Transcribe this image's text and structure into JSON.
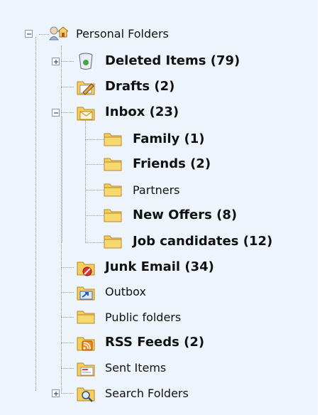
{
  "tree": {
    "root": {
      "label": "Personal Folders",
      "expanded": true
    },
    "items": {
      "deleted": {
        "label": "Deleted Items (79)",
        "expanded": false
      },
      "drafts": {
        "label": "Drafts (2)"
      },
      "inbox": {
        "label": "Inbox (23)",
        "expanded": true
      },
      "family": {
        "label": "Family (1)"
      },
      "friends": {
        "label": "Friends (2)"
      },
      "partners": {
        "label": "Partners"
      },
      "new_offers": {
        "label": "New Offers (8)"
      },
      "job_candidates": {
        "label": "Job candidates (12)"
      },
      "junk": {
        "label": "Junk Email (34)"
      },
      "outbox": {
        "label": "Outbox"
      },
      "public": {
        "label": "Public folders"
      },
      "rss": {
        "label": "RSS Feeds (2)"
      },
      "sent": {
        "label": "Sent Items"
      },
      "search": {
        "label": "Search Folders",
        "expanded": false
      }
    }
  },
  "colors": {
    "panel_bg": "#eef4fb",
    "folder_yellow": "#f5cf5a",
    "tree_line": "#9aa3ad"
  }
}
